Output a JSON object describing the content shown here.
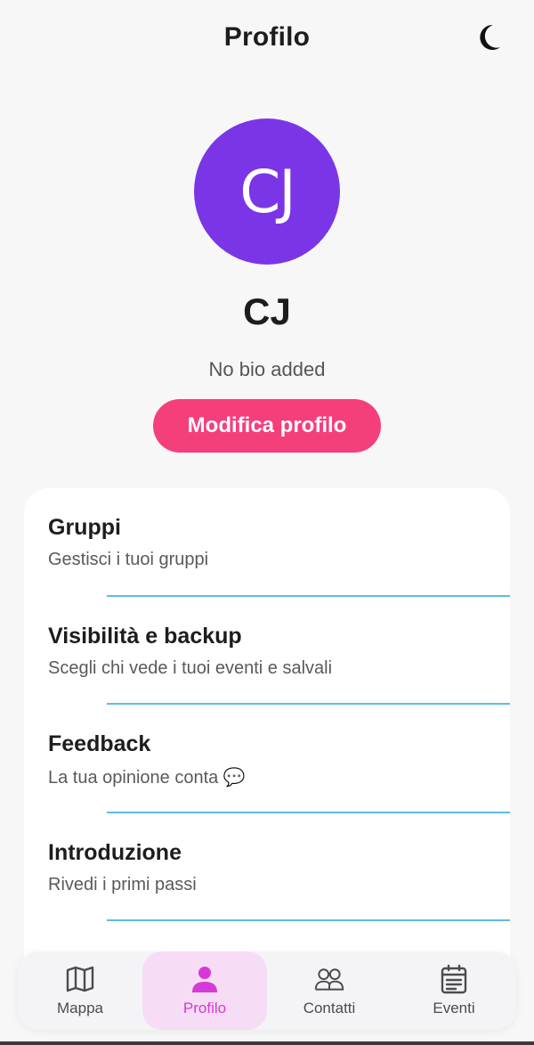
{
  "header": {
    "title": "Profilo",
    "theme_icon": "moon-icon"
  },
  "profile": {
    "initials": "CJ",
    "name": "CJ",
    "bio": "No bio added",
    "edit_label": "Modifica profilo",
    "avatar_color": "#7a36e6",
    "accent_color": "#f53f7b"
  },
  "menu": {
    "items": [
      {
        "title": "Gruppi",
        "subtitle": "Gestisci i tuoi gruppi"
      },
      {
        "title": "Visibilità e backup",
        "subtitle": "Scegli chi vede i tuoi eventi e salvali"
      },
      {
        "title": "Feedback",
        "subtitle": "La tua opinione conta 💬"
      },
      {
        "title": "Introduzione",
        "subtitle": "Rivedi i primi passi"
      }
    ],
    "divider_color": "#5bbde3"
  },
  "nav": {
    "items": [
      {
        "label": "Mappa",
        "icon": "map-icon",
        "active": false
      },
      {
        "label": "Profilo",
        "icon": "person-icon",
        "active": true
      },
      {
        "label": "Contatti",
        "icon": "people-icon",
        "active": false
      },
      {
        "label": "Eventi",
        "icon": "calendar-icon",
        "active": false
      }
    ],
    "active_color": "#d63ad6"
  }
}
